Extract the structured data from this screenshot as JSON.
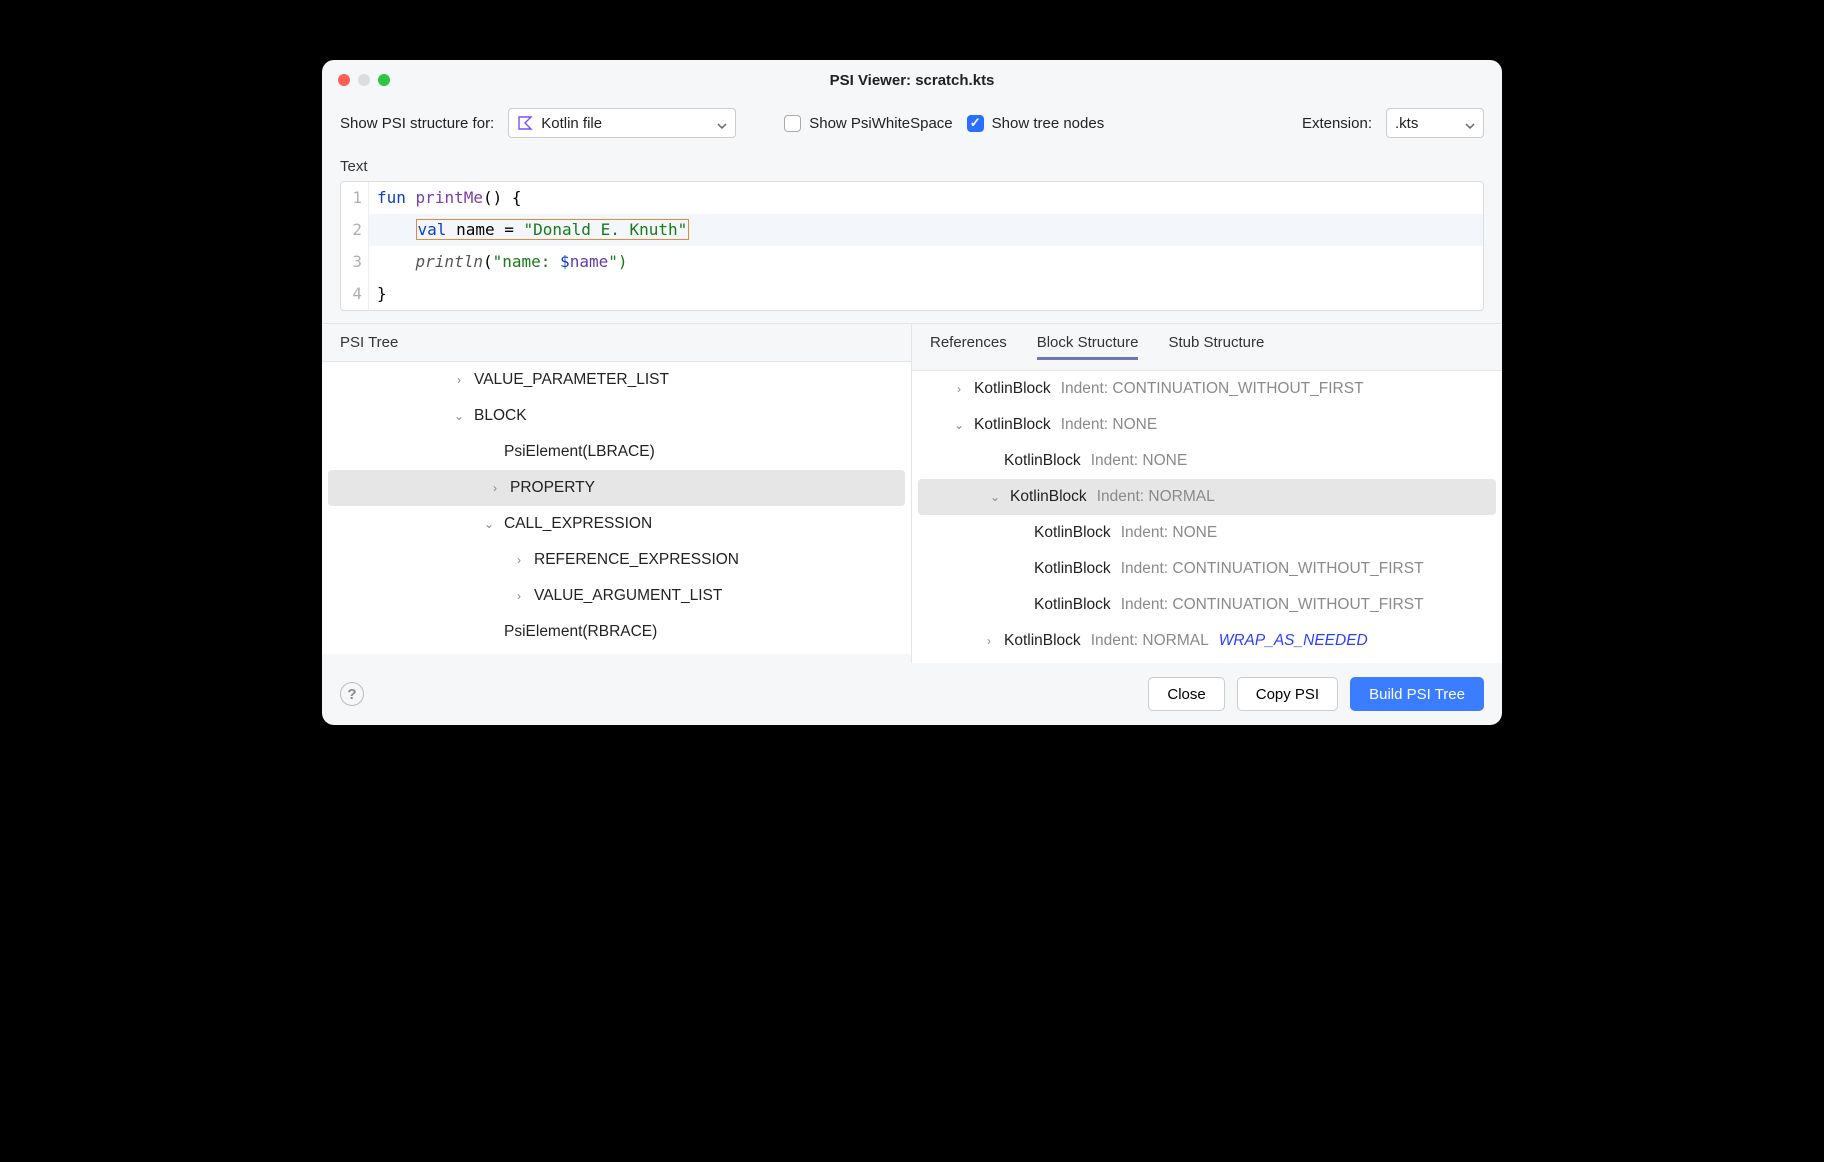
{
  "window": {
    "title": "PSI Viewer: scratch.kts"
  },
  "toolbar": {
    "show_label": "Show PSI structure for:",
    "lang_value": "Kotlin file",
    "whitespace_label": "Show PsiWhiteSpace",
    "whitespace_checked": false,
    "tree_nodes_label": "Show tree nodes",
    "tree_nodes_checked": true,
    "extension_label": "Extension:",
    "extension_value": ".kts"
  },
  "sections": {
    "text_label": "Text",
    "psi_tree_label": "PSI Tree"
  },
  "code": {
    "lines": [
      {
        "n": "1"
      },
      {
        "n": "2"
      },
      {
        "n": "3"
      },
      {
        "n": "4"
      }
    ],
    "tokens": {
      "fun": "fun",
      "printMe": "printMe",
      "openParen": "() {",
      "val": "val",
      "name_eq": " name = ",
      "str": "\"Donald E. Knuth\"",
      "println": "println",
      "arg_open": "(",
      "arg_str": "\"name: ",
      "dollar": "$",
      "name_ref": "name",
      "arg_close": "\")",
      "rbrace": "}"
    }
  },
  "psi_tree": [
    {
      "indent": 3,
      "arrow": "›",
      "label": "VALUE_PARAMETER_LIST",
      "sel": false
    },
    {
      "indent": 3,
      "arrow": "⌄",
      "label": "BLOCK",
      "sel": false
    },
    {
      "indent": 4,
      "arrow": "",
      "label": "PsiElement(LBRACE)",
      "sel": false
    },
    {
      "indent": 4,
      "arrow": "›",
      "label": "PROPERTY",
      "sel": true
    },
    {
      "indent": 4,
      "arrow": "⌄",
      "label": "CALL_EXPRESSION",
      "sel": false
    },
    {
      "indent": 5,
      "arrow": "›",
      "label": "REFERENCE_EXPRESSION",
      "sel": false
    },
    {
      "indent": 5,
      "arrow": "›",
      "label": "VALUE_ARGUMENT_LIST",
      "sel": false
    },
    {
      "indent": 4,
      "arrow": "",
      "label": "PsiElement(RBRACE)",
      "sel": false
    }
  ],
  "right_tabs": {
    "references": "References",
    "block_structure": "Block Structure",
    "stub_structure": "Stub Structure"
  },
  "block_tree": [
    {
      "indent": 1,
      "arrow": "›",
      "main": "KotlinBlock",
      "muted": "Indent: CONTINUATION_WITHOUT_FIRST",
      "sel": false,
      "wrap": ""
    },
    {
      "indent": 1,
      "arrow": "⌄",
      "main": "KotlinBlock",
      "muted": "Indent: NONE",
      "sel": false,
      "wrap": ""
    },
    {
      "indent": 2,
      "arrow": "",
      "main": "KotlinBlock",
      "muted": "Indent: NONE",
      "sel": false,
      "wrap": ""
    },
    {
      "indent": 2,
      "arrow": "⌄",
      "main": "KotlinBlock",
      "muted": "Indent: NORMAL",
      "sel": true,
      "wrap": ""
    },
    {
      "indent": 3,
      "arrow": "",
      "main": "KotlinBlock",
      "muted": "Indent: NONE",
      "sel": false,
      "wrap": ""
    },
    {
      "indent": 3,
      "arrow": "",
      "main": "KotlinBlock",
      "muted": "Indent: CONTINUATION_WITHOUT_FIRST",
      "sel": false,
      "wrap": ""
    },
    {
      "indent": 3,
      "arrow": "",
      "main": "KotlinBlock",
      "muted": "Indent: CONTINUATION_WITHOUT_FIRST",
      "sel": false,
      "wrap": ""
    },
    {
      "indent": 2,
      "arrow": "›",
      "main": "KotlinBlock",
      "muted": "Indent: NORMAL",
      "sel": false,
      "wrap": "WRAP_AS_NEEDED"
    }
  ],
  "footer": {
    "close": "Close",
    "copy": "Copy PSI",
    "build": "Build PSI Tree"
  }
}
